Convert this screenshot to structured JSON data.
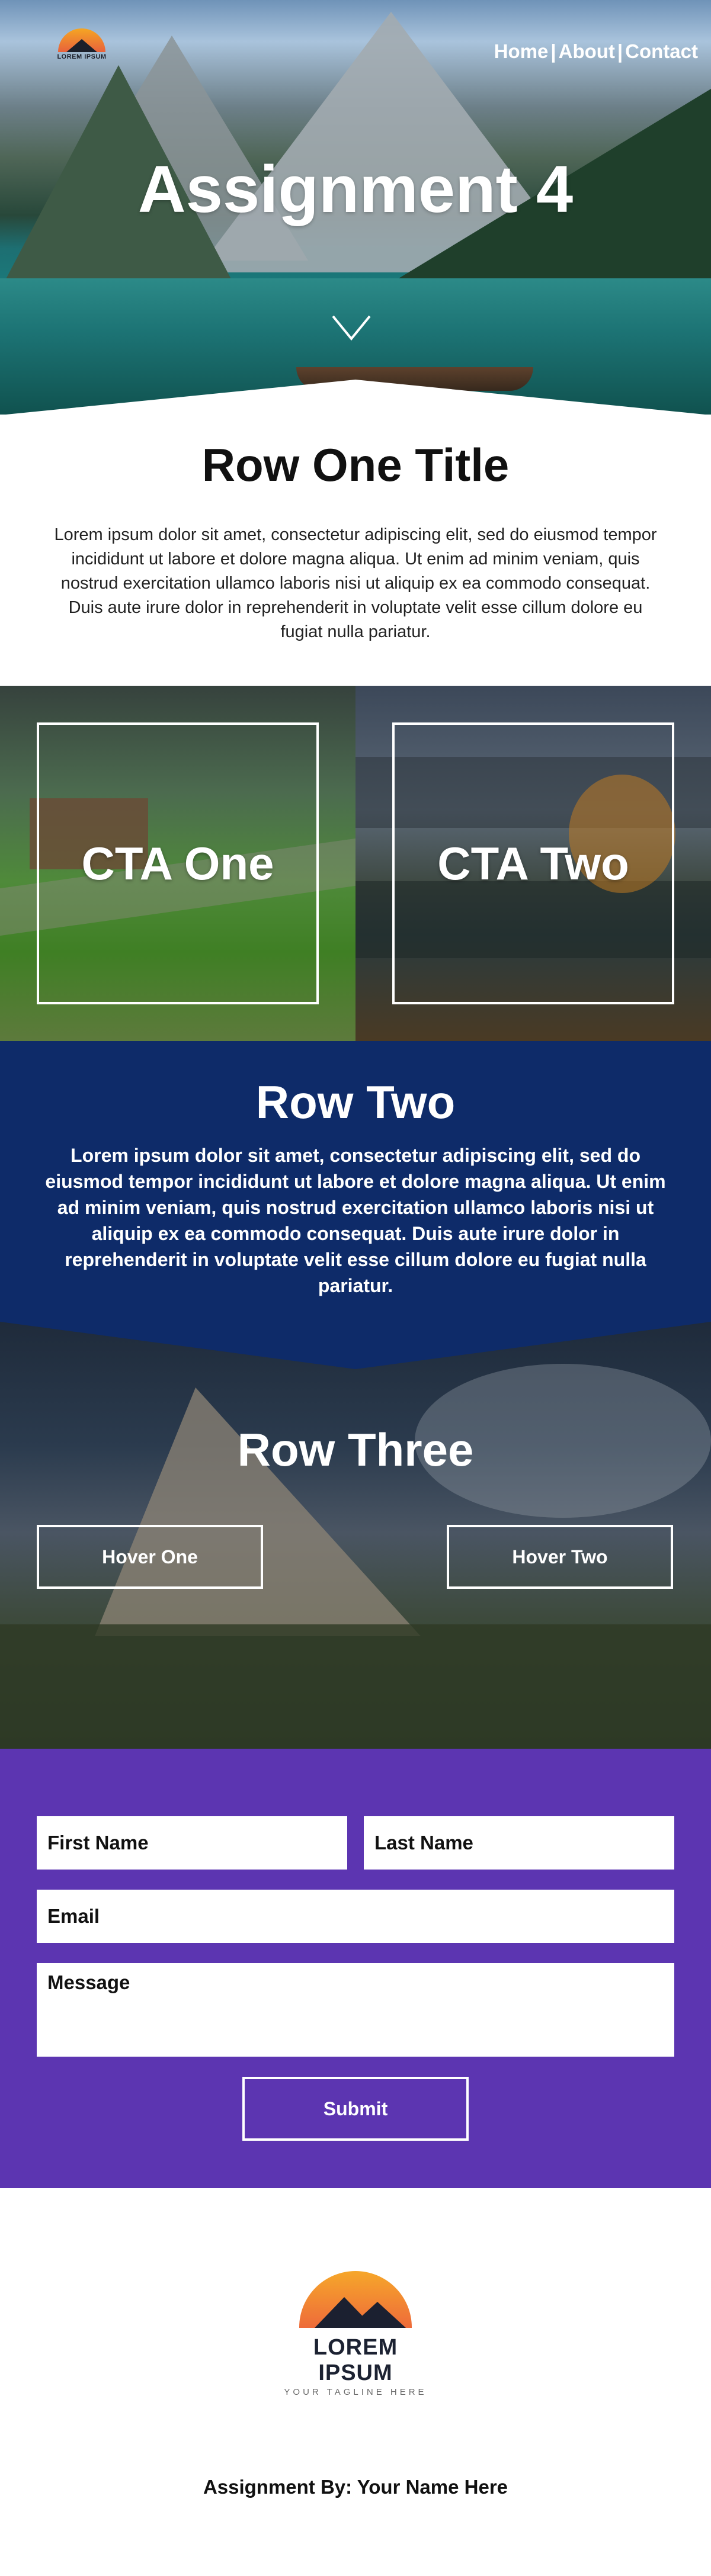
{
  "header": {
    "logo_text": "LOREM IPSUM",
    "nav": {
      "home": "Home",
      "about": "About",
      "contact": "Contact",
      "separator": "|"
    },
    "title": "Assignment 4",
    "scroll_icon": "chevron-down-icon"
  },
  "row_one": {
    "title": "Row One Title",
    "body": "Lorem ipsum dolor sit amet, consectetur adipiscing elit, sed do eiusmod tempor incididunt ut labore et dolore magna aliqua. Ut enim ad minim veniam, quis nostrud exercitation ullamco laboris nisi ut aliquip ex ea commodo consequat. Duis aute irure dolor in reprehenderit in voluptate velit esse cillum dolore eu fugiat nulla pariatur."
  },
  "cta": {
    "one": "CTA One",
    "two": "CTA Two"
  },
  "row_two": {
    "title": "Row Two",
    "body": "Lorem ipsum dolor sit amet, consectetur adipiscing elit, sed do eiusmod tempor incididunt ut labore et dolore magna aliqua. Ut enim ad minim veniam, quis nostrud exercitation ullamco laboris nisi ut aliquip ex ea commodo consequat. Duis aute irure dolor in reprehenderit in voluptate velit esse cillum dolore eu fugiat nulla pariatur.",
    "bg_color": "#0e2b69"
  },
  "row_three": {
    "title": "Row Three",
    "hover_one": "Hover One",
    "hover_two": "Hover Two"
  },
  "form": {
    "first_name": "First Name",
    "last_name": "Last Name",
    "email": "Email",
    "message": "Message",
    "submit": "Submit",
    "bg_color": "#5c35b1"
  },
  "footer": {
    "logo_name": "LOREM IPSUM",
    "logo_tagline": "YOUR TAGLINE HERE",
    "credit": "Assignment By: Your Name Here"
  }
}
